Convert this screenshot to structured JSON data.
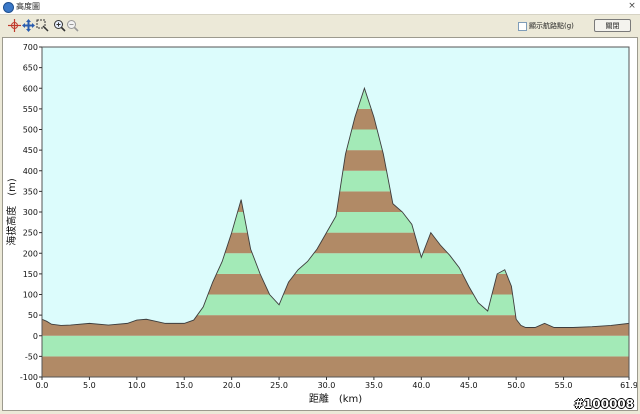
{
  "window": {
    "title": "高度圖",
    "close_glyph": "×"
  },
  "toolbar": {
    "tools": [
      {
        "name": "crosshair-tool-icon"
      },
      {
        "name": "pan-tool-icon"
      },
      {
        "name": "select-zoom-tool-icon"
      },
      {
        "name": "zoom-in-icon"
      },
      {
        "name": "zoom-out-icon"
      }
    ],
    "checkbox_label": "顯示航路點(g)",
    "checkbox_checked": false,
    "close_button": "關閉"
  },
  "chart_data": {
    "type": "area",
    "title": "",
    "xlabel": "距離　(km)",
    "ylabel": "海拔高度　(m)",
    "xlim": [
      0,
      61.9
    ],
    "ylim": [
      -100,
      700
    ],
    "x_ticks": [
      "0.0",
      "5.0",
      "10.0",
      "15.0",
      "20.0",
      "25.0",
      "30.0",
      "35.0",
      "40.0",
      "45.0",
      "50.0",
      "55.0",
      "61.9"
    ],
    "y_ticks": [
      "700",
      "650",
      "600",
      "550",
      "500",
      "450",
      "400",
      "350",
      "300",
      "250",
      "200",
      "150",
      "100",
      "50",
      "0",
      "-50",
      "-100"
    ],
    "band_height_m": 50,
    "band_colors": [
      "#b18a66",
      "#a3eab7"
    ],
    "plot_background": "#dcfcfc",
    "series": [
      {
        "x": [
          0,
          0.5,
          1,
          2,
          3,
          5,
          7,
          9,
          10,
          11,
          12,
          13,
          15,
          16,
          17,
          18,
          19,
          20,
          21,
          22,
          23,
          24,
          25,
          26,
          27,
          28,
          29,
          30,
          31,
          32,
          33,
          34,
          35,
          36,
          37,
          38,
          39,
          40,
          41,
          42,
          43,
          44,
          45,
          46,
          47,
          48,
          48.8,
          49.5,
          50,
          50.5,
          51,
          52,
          53,
          54,
          55,
          56,
          58,
          60,
          61.9
        ],
        "y": [
          40,
          35,
          28,
          25,
          26,
          30,
          26,
          30,
          38,
          40,
          35,
          30,
          30,
          38,
          70,
          130,
          180,
          250,
          330,
          210,
          150,
          100,
          75,
          130,
          160,
          180,
          210,
          250,
          290,
          440,
          530,
          600,
          530,
          440,
          320,
          300,
          270,
          190,
          250,
          220,
          195,
          165,
          120,
          80,
          60,
          150,
          160,
          120,
          40,
          25,
          20,
          20,
          30,
          20,
          20,
          20,
          22,
          25,
          30
        ]
      }
    ]
  },
  "watermark": "#100008"
}
